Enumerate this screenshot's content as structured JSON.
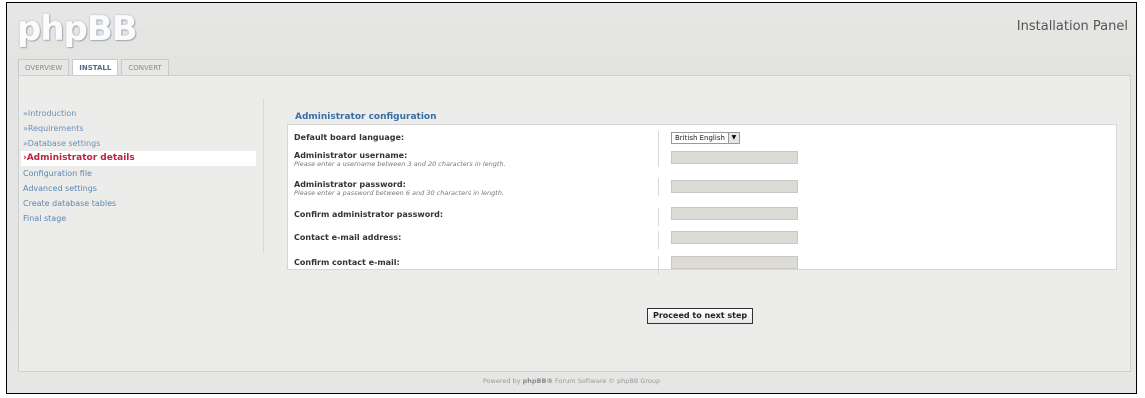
{
  "header": {
    "logo": "phpBB",
    "panel_title": "Installation Panel"
  },
  "tabs": [
    {
      "label": "OVERVIEW",
      "active": false
    },
    {
      "label": "INSTALL",
      "active": true
    },
    {
      "label": "CONVERT",
      "active": false
    }
  ],
  "sidebar": {
    "items": [
      {
        "label": "»Introduction",
        "state": "done"
      },
      {
        "label": "»Requirements",
        "state": "done"
      },
      {
        "label": "»Database settings",
        "state": "done"
      },
      {
        "label": "›Administrator details",
        "state": "current"
      },
      {
        "label": "Configuration file",
        "state": "pending"
      },
      {
        "label": "Advanced settings",
        "state": "pending"
      },
      {
        "label": "Create database tables",
        "state": "pending"
      },
      {
        "label": "Final stage",
        "state": "pending"
      }
    ]
  },
  "form": {
    "legend": "Administrator configuration",
    "language": {
      "label": "Default board language:",
      "selected": "British English"
    },
    "username": {
      "label": "Administrator username:",
      "hint": "Please enter a username between 3 and 20 characters in length.",
      "value": ""
    },
    "password": {
      "label": "Administrator password:",
      "hint": "Please enter a password between 6 and 30 characters in length.",
      "value": ""
    },
    "confirm_password": {
      "label": "Confirm administrator password:",
      "value": ""
    },
    "email": {
      "label": "Contact e-mail address:",
      "value": ""
    },
    "confirm_email": {
      "label": "Confirm contact e-mail:",
      "value": ""
    }
  },
  "actions": {
    "proceed_label": "Proceed to next step"
  },
  "footer": {
    "prefix": "Powered by ",
    "brand": "phpBB®",
    "suffix": " Forum Software © phpBB Group"
  },
  "colors": {
    "accent": "#3b6ea5",
    "current_step": "#c02040",
    "link": "#5a86b0"
  }
}
